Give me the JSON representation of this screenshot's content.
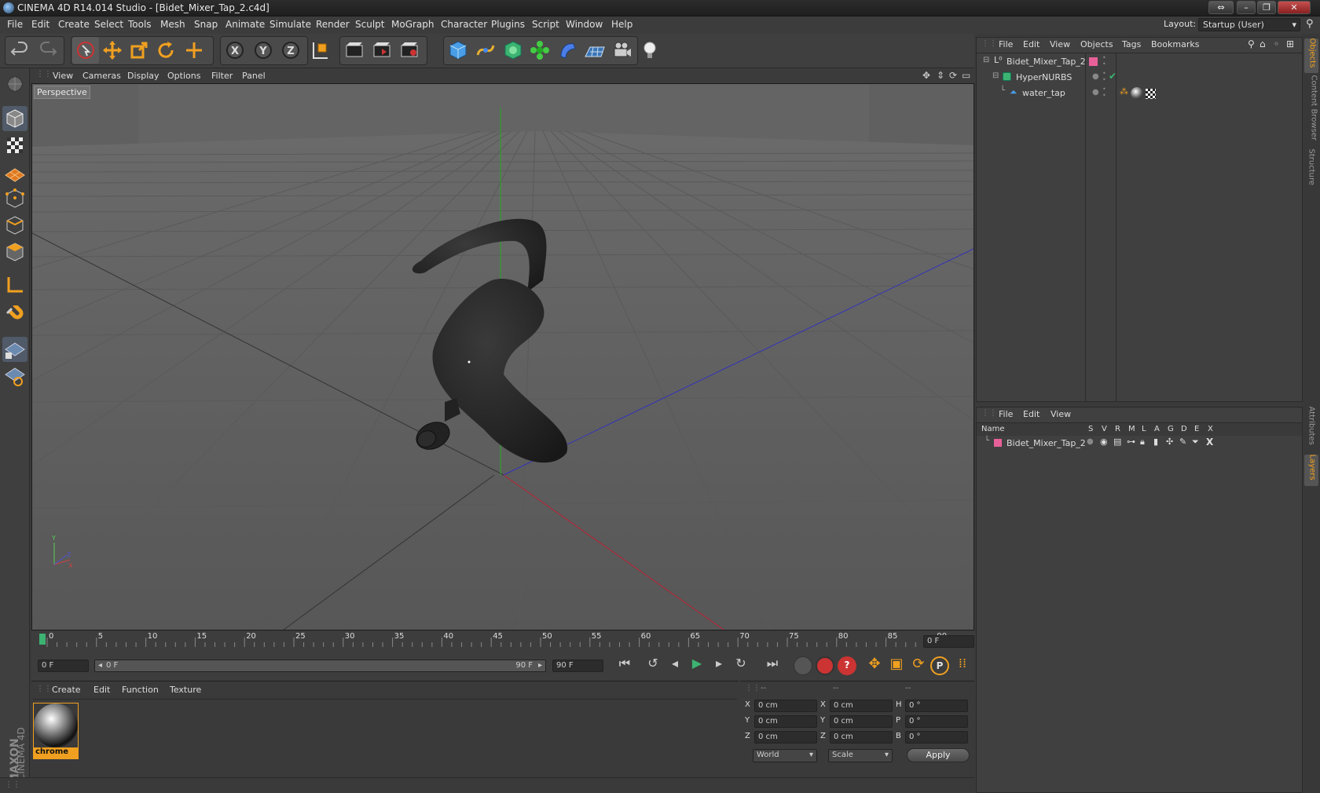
{
  "window": {
    "title": "CINEMA 4D R14.014 Studio - [Bidet_Mixer_Tap_2.c4d]"
  },
  "menu": [
    "File",
    "Edit",
    "Create",
    "Select",
    "Tools",
    "Mesh",
    "Snap",
    "Animate",
    "Simulate",
    "Render",
    "Sculpt",
    "MoGraph",
    "Character",
    "Plugins",
    "Script",
    "Window",
    "Help"
  ],
  "layout": {
    "label": "Layout:",
    "value": "Startup (User)"
  },
  "viewport": {
    "menu": [
      "View",
      "Cameras",
      "Display",
      "Options",
      "Filter",
      "Panel"
    ],
    "label": "Perspective"
  },
  "timeline": {
    "ticks": [
      "0",
      "5",
      "10",
      "15",
      "20",
      "25",
      "30",
      "35",
      "40",
      "45",
      "50",
      "55",
      "60",
      "65",
      "70",
      "75",
      "80",
      "85",
      "90"
    ],
    "current_frame": "0 F",
    "start": "0 F",
    "range_start": "0 F",
    "range_end": "90 F",
    "end": "90 F"
  },
  "materials": {
    "menu": [
      "Create",
      "Edit",
      "Function",
      "Texture"
    ],
    "items": [
      {
        "name": "chrome"
      }
    ]
  },
  "coords": {
    "headers": [
      "--",
      "--",
      "--"
    ],
    "rows": [
      {
        "a_label": "X",
        "a_val": "0 cm",
        "b_label": "X",
        "b_val": "0 cm",
        "c_label": "H",
        "c_val": "0 °"
      },
      {
        "a_label": "Y",
        "a_val": "0 cm",
        "b_label": "Y",
        "b_val": "0 cm",
        "c_label": "P",
        "c_val": "0 °"
      },
      {
        "a_label": "Z",
        "a_val": "0 cm",
        "b_label": "Z",
        "b_val": "0 cm",
        "c_label": "B",
        "c_val": "0 °"
      }
    ],
    "space": "World",
    "mode": "Scale",
    "apply": "Apply"
  },
  "objects": {
    "menu": [
      "File",
      "Edit",
      "View",
      "Objects",
      "Tags",
      "Bookmarks"
    ],
    "tree": [
      {
        "name": "Bidet_Mixer_Tap_2",
        "indent": 0
      },
      {
        "name": "HyperNURBS",
        "indent": 1
      },
      {
        "name": "water_tap",
        "indent": 2
      }
    ]
  },
  "layers": {
    "menu": [
      "File",
      "Edit",
      "View"
    ],
    "columns": [
      "Name",
      "S",
      "V",
      "R",
      "M",
      "L",
      "A",
      "G",
      "D",
      "E",
      "X"
    ],
    "rows": [
      {
        "name": "Bidet_Mixer_Tap_2"
      }
    ]
  },
  "right_tabs": [
    "Objects",
    "Content Browser",
    "Structure",
    "Attributes",
    "Layers"
  ],
  "branding": {
    "maxon": "MAXON",
    "product": "CINEMA 4D"
  },
  "colors": {
    "accent_orange": "#f0a020",
    "layer_pink": "#e8609a",
    "axis_x": "#b33",
    "axis_y": "#3a3",
    "axis_z": "#33b"
  }
}
